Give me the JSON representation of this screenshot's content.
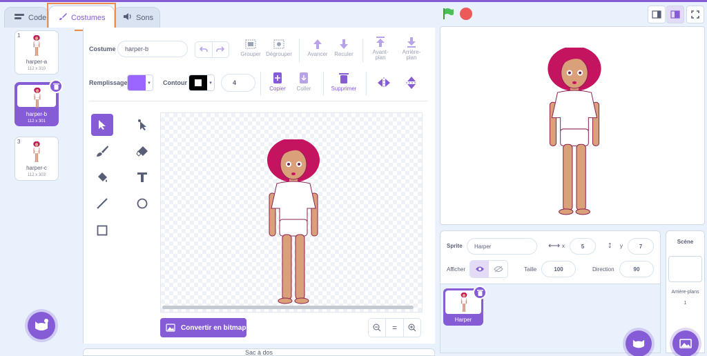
{
  "tabs": {
    "code": "Code",
    "costumes": "Costumes",
    "sounds": "Sons"
  },
  "costumes": [
    {
      "number": "1",
      "name": "harper-a",
      "size": "112 x 310"
    },
    {
      "number": "2",
      "name": "harper-b",
      "size": "112 x 301"
    },
    {
      "number": "3",
      "name": "harper-c",
      "size": "112 x 303"
    }
  ],
  "editor": {
    "costume_label": "Costume",
    "costume_name": "harper-b",
    "group": "Grouper",
    "ungroup": "Dégrouper",
    "forward": "Avancer",
    "backward": "Reculer",
    "front_line1": "Avant-",
    "front_line2": "plan",
    "back_line1": "Arrière-",
    "back_line2": "plan",
    "fill_label": "Remplissage",
    "outline_label": "Contour",
    "outline_width": "4",
    "copy": "Copier",
    "paste": "Coller",
    "delete": "Supprimer",
    "convert_bitmap": "Convertir en bitmap",
    "zoom_reset": "="
  },
  "sprite": {
    "label": "Sprite",
    "name": "Harper",
    "x_label": "x",
    "x": "5",
    "y_label": "y",
    "y": "7",
    "show_label": "Afficher",
    "size_label": "Taille",
    "size": "100",
    "direction_label": "Direction",
    "direction": "90",
    "thumb_name": "Harper"
  },
  "stage_panel": {
    "title": "Scène",
    "backdrops_label": "Arrière-plans",
    "backdrops_count": "1"
  },
  "bottom_bar": "Sac à dos",
  "colors": {
    "accent": "#855cd6",
    "fill_color": "#9966ff",
    "outline_color": "#000000",
    "highlight": "#f28b47",
    "green_flag": "#4cbf56",
    "stop": "#ec5959"
  }
}
